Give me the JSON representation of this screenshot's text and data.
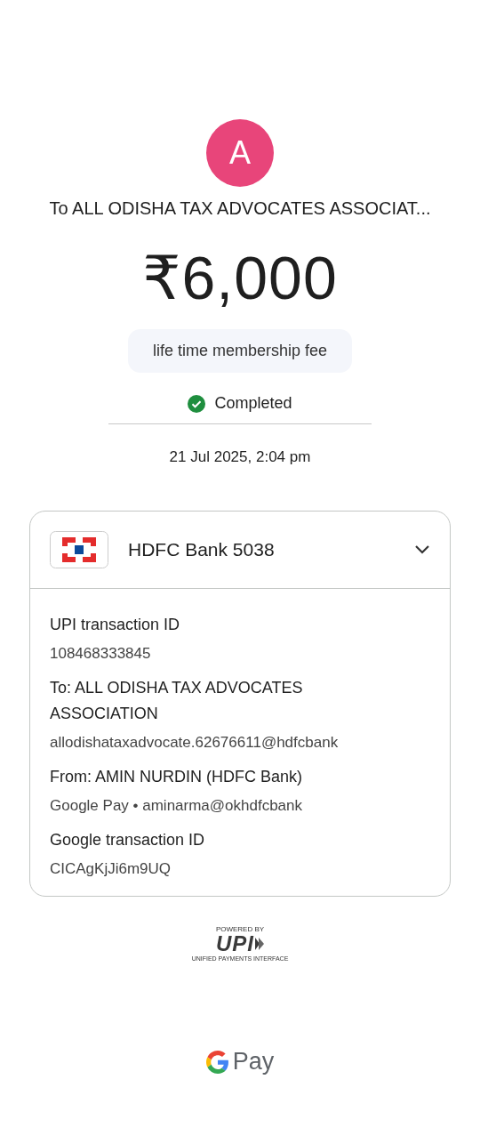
{
  "payee": {
    "avatar_letter": "A",
    "title": "To ALL ODISHA TAX ADVOCATES ASSOCIAT..."
  },
  "amount": "₹6,000",
  "note": "life time membership fee",
  "status": {
    "kind": "completed",
    "label": "Completed"
  },
  "date": "21 Jul 2025, 2:04 pm",
  "account": {
    "name": "HDFC Bank 5038"
  },
  "details": [
    {
      "label": "UPI transaction ID",
      "value": "108468333845"
    },
    {
      "label": "To: ALL ODISHA TAX ADVOCATES ASSOCIATION",
      "value": "allodishataxadvocate.62676611@hdfcbank"
    },
    {
      "label": "From: AMIN NURDIN (HDFC Bank)",
      "value": "Google Pay • aminarma@okhdfcbank"
    },
    {
      "label": "Google transaction ID",
      "value": "CICAgKjJi6m9UQ"
    }
  ],
  "footer": {
    "powered_by": "POWERED BY",
    "upi_label": "UPI",
    "upi_tagline": "UNIFIED PAYMENTS INTERFACE",
    "brand": "Pay"
  }
}
